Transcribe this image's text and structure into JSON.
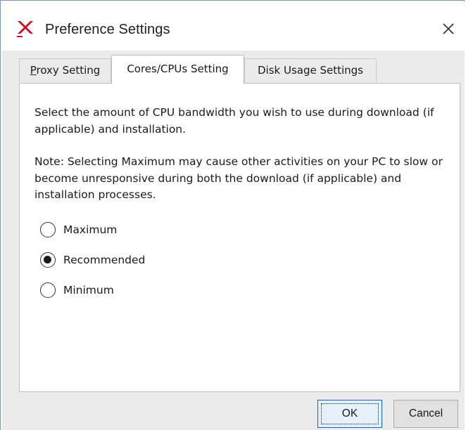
{
  "window": {
    "title": "Preference Settings",
    "close_glyph": "×",
    "logo_icon": "xilinx-logo-icon",
    "logo_color": "#c8102e"
  },
  "tabs": [
    {
      "label_mnemonic": "P",
      "label_rest": "roxy Setting",
      "active": false
    },
    {
      "label": "Cores/CPUs Setting",
      "active": true
    },
    {
      "label": "Disk Usage Settings",
      "active": false
    }
  ],
  "panel": {
    "description": "Select the amount of CPU bandwidth you wish to use during download (if applicable) and installation.",
    "note": "Note: Selecting Maximum may cause other activities on your PC to slow or become unresponsive during both the download (if applicable) and installation processes.",
    "options": [
      {
        "label": "Maximum",
        "checked": false
      },
      {
        "label": "Recommended",
        "checked": true
      },
      {
        "label": "Minimum",
        "checked": false
      }
    ]
  },
  "buttons": {
    "ok": "OK",
    "cancel": "Cancel"
  },
  "colors": {
    "accent": "#0a64c8",
    "dialog_background": "#ececec",
    "panel_background": "#ffffff"
  }
}
